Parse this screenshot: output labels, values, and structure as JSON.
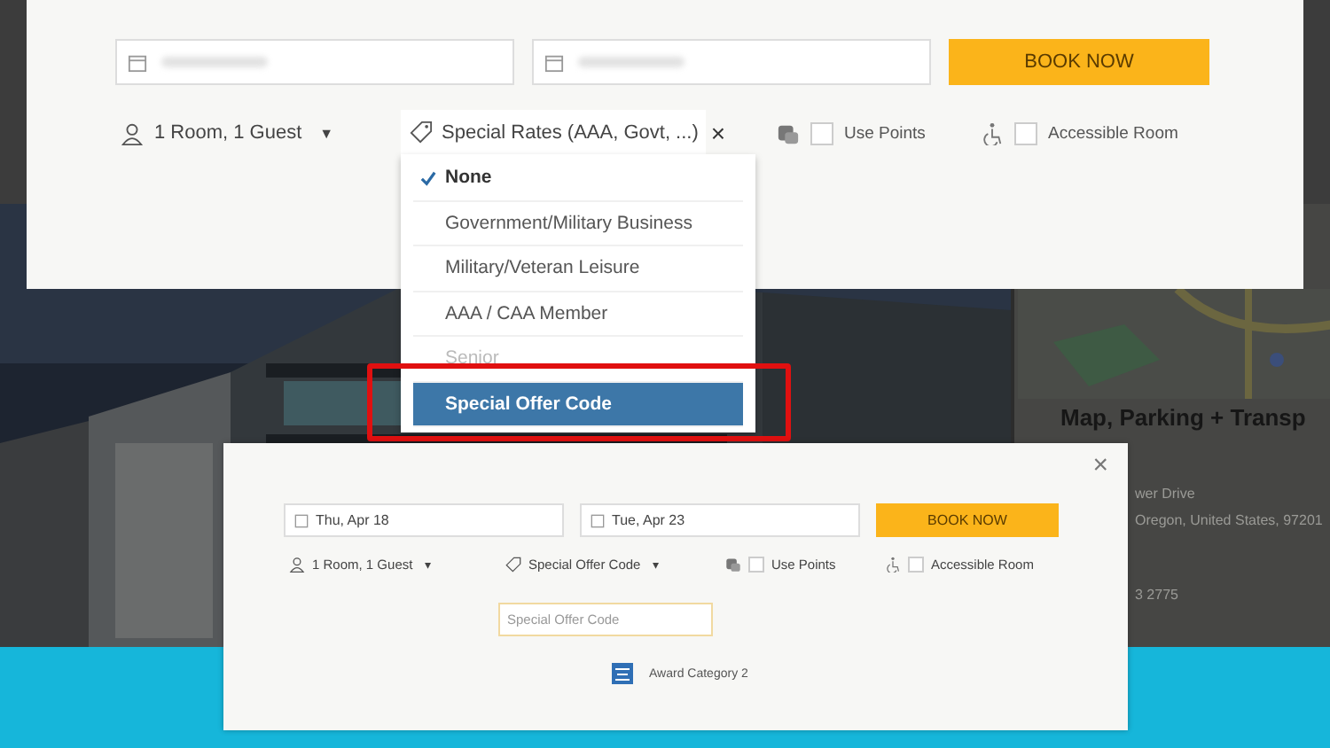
{
  "booking_panel": {
    "date_fields": [
      {
        "kind": "date"
      },
      {
        "kind": "date"
      }
    ],
    "book_button": "BOOK NOW",
    "rooms": {
      "label": "1 Room, 1 Guest",
      "caret": "▼"
    },
    "use_points": {
      "label": "Use Points",
      "checked": false
    },
    "accessible_room": {
      "label": "Accessible Room",
      "checked": false
    }
  },
  "rates_dropdown": {
    "label": "Special Rates (AAA, Govt, ...)",
    "close": "×",
    "options": [
      {
        "label": "None",
        "selected": true,
        "highlighted": false
      },
      {
        "label": "Government/Military Business",
        "selected": false,
        "highlighted": false
      },
      {
        "label": "Military/Veteran Leisure",
        "selected": false,
        "highlighted": false
      },
      {
        "label": "AAA / CAA Member",
        "selected": false,
        "highlighted": false
      },
      {
        "label": "Senior",
        "selected": false,
        "highlighted": false
      },
      {
        "label": "Special Offer Code",
        "selected": false,
        "highlighted": true
      }
    ]
  },
  "map_section": {
    "title": "Map, Parking + Transp",
    "lines": [
      "wer Drive",
      "Oregon, United States, 97201",
      "3 2775"
    ]
  },
  "popup": {
    "close": "×",
    "date_fields": [
      "Thu, Apr 18",
      "Tue, Apr 23"
    ],
    "book_button": "BOOK NOW",
    "rooms": {
      "label": "1 Room, 1 Guest",
      "caret": "▾"
    },
    "offer": {
      "label": "Special Offer Code",
      "caret": "▾"
    },
    "use_points": {
      "label": "Use Points",
      "checked": false
    },
    "accessible_room": {
      "label": "Accessible Room",
      "checked": false
    },
    "code_field": {
      "placeholder": "Special Offer Code"
    },
    "award": "Award Category 2"
  }
}
